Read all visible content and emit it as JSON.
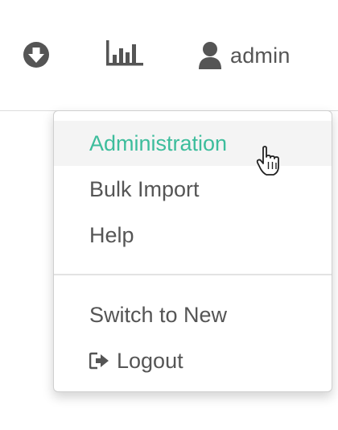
{
  "navbar": {
    "download_icon": "circle-arrow-down-icon",
    "chart_icon": "bar-chart-icon",
    "user_icon": "user-icon",
    "username": "admin"
  },
  "dropdown": {
    "items": [
      {
        "label": "Administration",
        "active": true
      },
      {
        "label": "Bulk Import"
      },
      {
        "label": "Help"
      },
      {
        "label": "Switch to New"
      },
      {
        "label": "Logout",
        "icon": "sign-out-icon"
      }
    ]
  },
  "colors": {
    "accent": "#3dbd9c",
    "text": "#555555",
    "hover_bg": "#f4f4f4",
    "icon": "#555555"
  }
}
